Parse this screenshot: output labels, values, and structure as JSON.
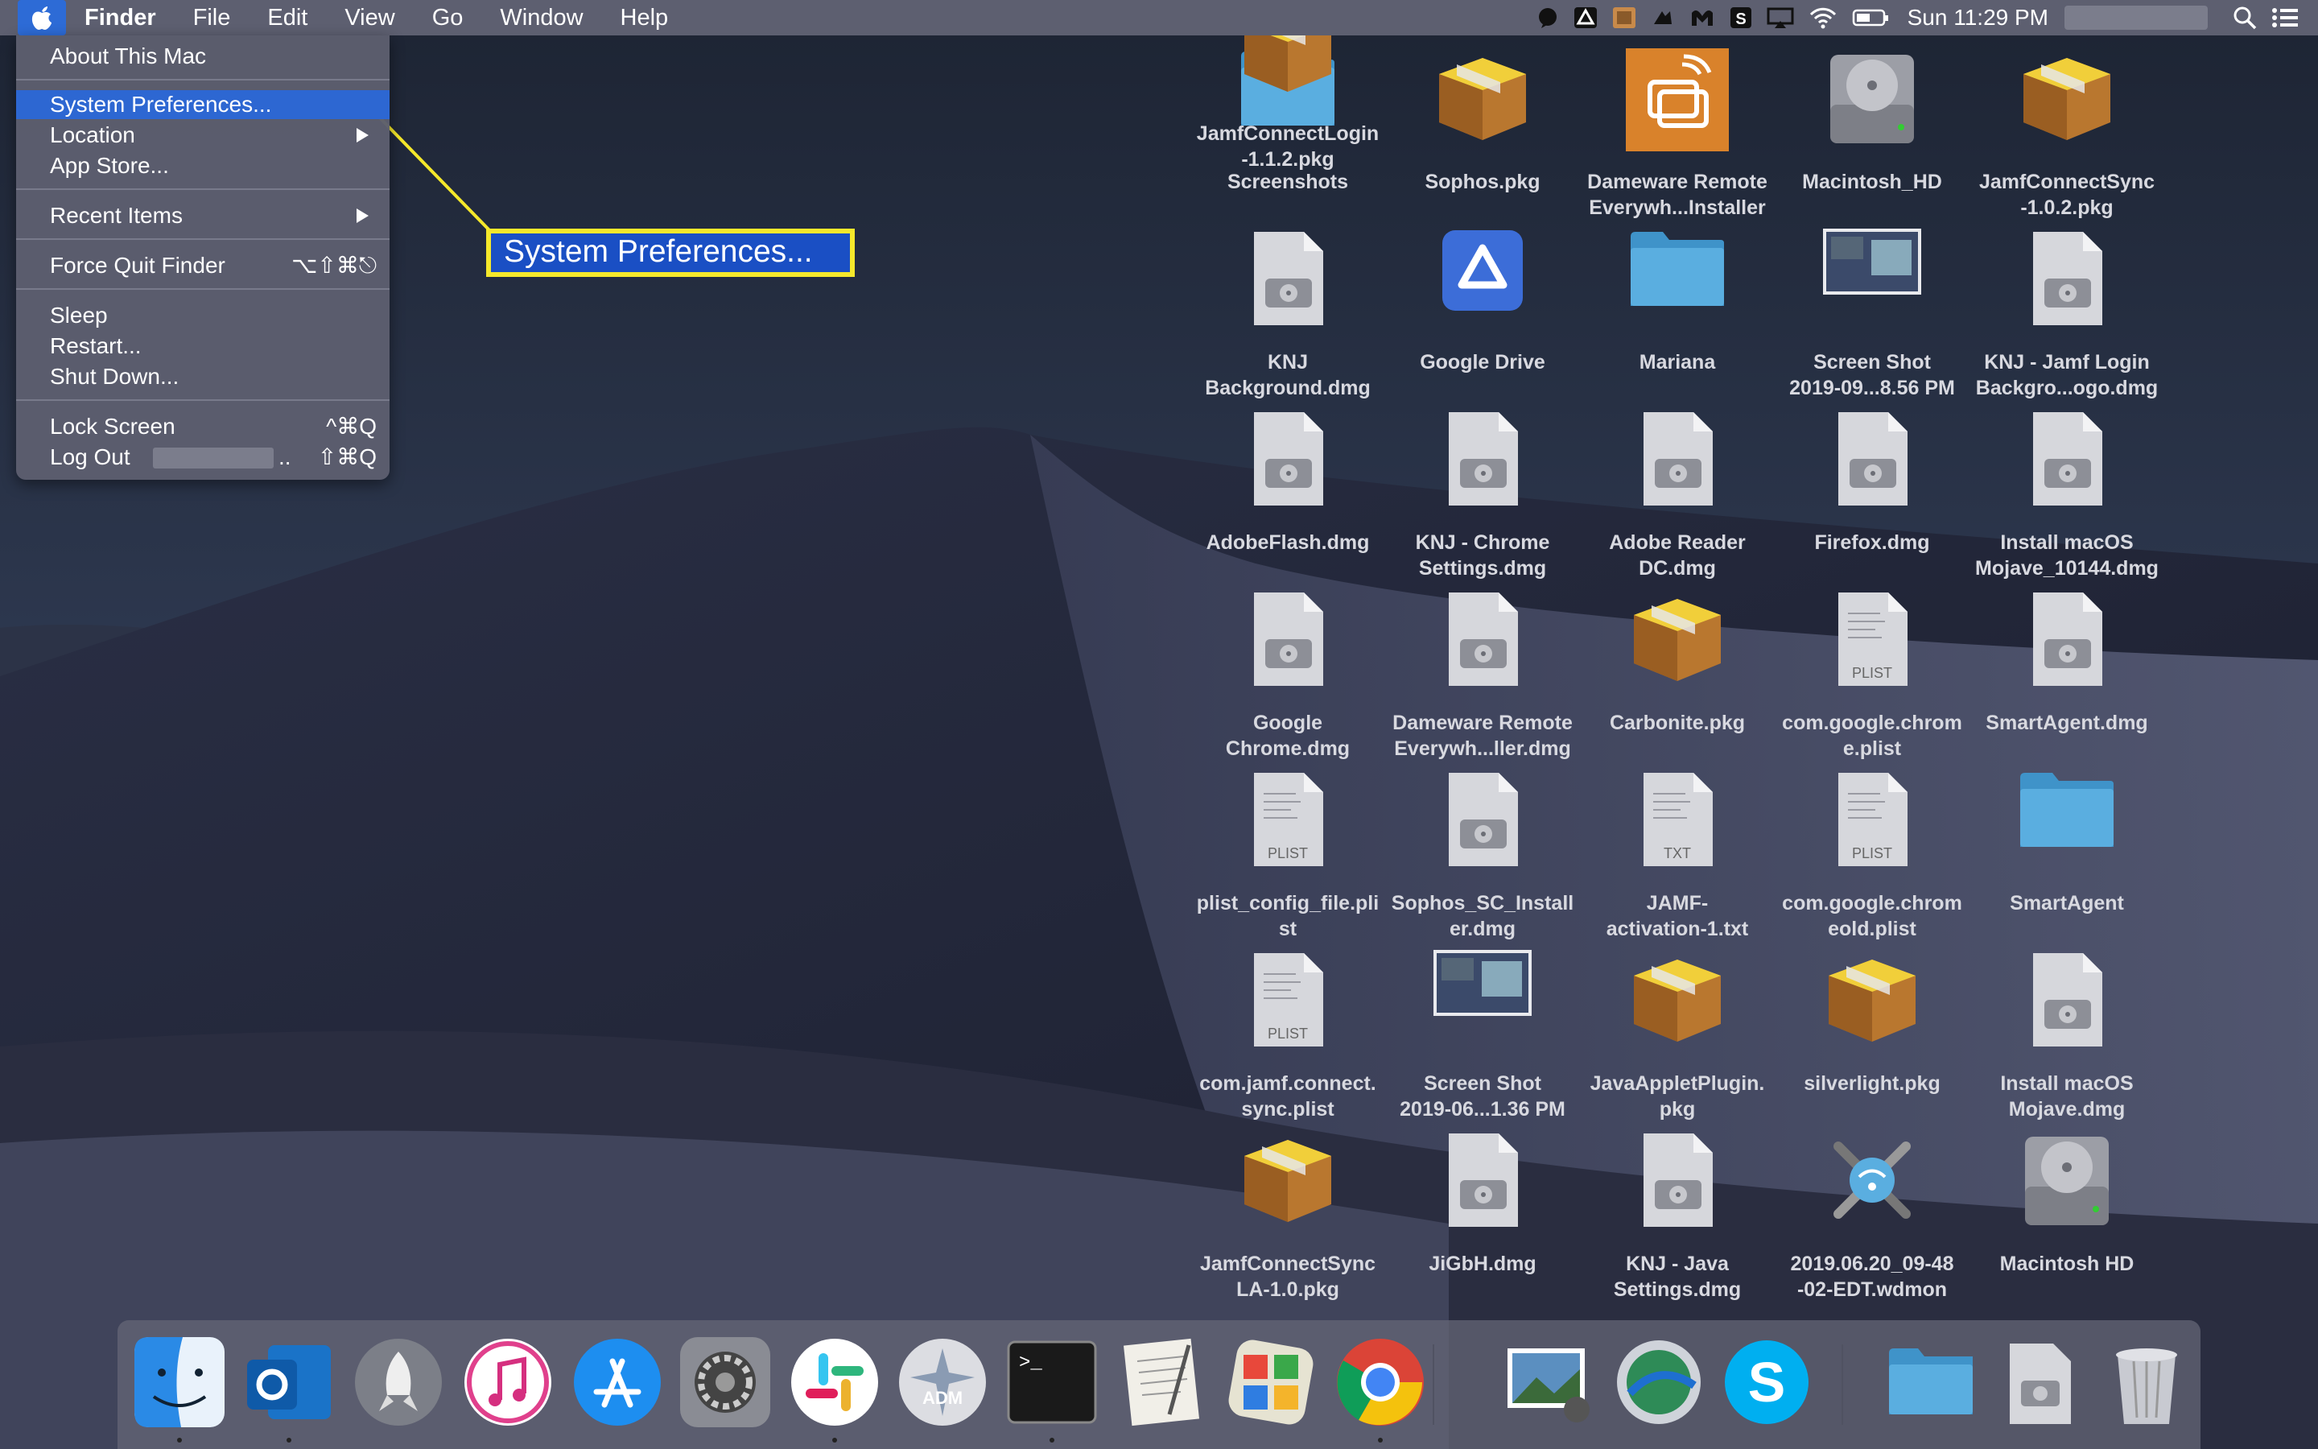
{
  "menubar": {
    "app_name": "Finder",
    "menus": [
      "File",
      "Edit",
      "View",
      "Go",
      "Window",
      "Help"
    ],
    "clock": "Sun 11:29 PM",
    "status_icons": [
      "notification-icon",
      "google-drive-icon",
      "menu-app-icon",
      "dropbox-like-icon",
      "malwarebytes-icon",
      "skype-status-icon",
      "airplay-icon",
      "wifi-icon",
      "battery-icon",
      "spotlight-search-icon",
      "notification-center-icon"
    ]
  },
  "apple_menu": {
    "items": [
      {
        "label": "About This Mac",
        "shortcut": ""
      },
      {
        "label": "System Preferences...",
        "shortcut": "",
        "highlighted": true
      },
      {
        "label": "Location",
        "shortcut": "",
        "submenu": true
      },
      {
        "label": "App Store...",
        "shortcut": ""
      },
      {
        "label": "Recent Items",
        "shortcut": "",
        "submenu": true
      },
      {
        "label": "Force Quit Finder",
        "shortcut": "⌥⇧⌘⎋"
      },
      {
        "label": "Sleep",
        "shortcut": ""
      },
      {
        "label": "Restart...",
        "shortcut": ""
      },
      {
        "label": "Shut Down...",
        "shortcut": ""
      },
      {
        "label": "Lock Screen",
        "shortcut": "^⌘Q"
      },
      {
        "label": "Log Out",
        "shortcut": "⇧⌘Q",
        "suffix": ".."
      }
    ]
  },
  "callout": {
    "label": "System Preferences...",
    "color": "#f5e82b"
  },
  "desktop_icons": [
    {
      "label": "Screenshots",
      "icon": "folder-icon"
    },
    {
      "label": "Sophos.pkg",
      "icon": "package-icon"
    },
    {
      "label": "Dameware Remote\nEverywh...Installer",
      "icon": "dameware-app-icon"
    },
    {
      "label": "Macintosh_HD",
      "icon": "hard-drive-icon"
    },
    {
      "label": "JamfConnectSync\n-1.0.2.pkg",
      "icon": "package-icon"
    },
    {
      "label": "KNJ\nBackground.dmg",
      "icon": "disk-image-icon"
    },
    {
      "label": "Google Drive",
      "icon": "google-drive-icon"
    },
    {
      "label": "Mariana",
      "icon": "folder-icon"
    },
    {
      "label": "Screen Shot\n2019-09...8.56 PM",
      "icon": "screenshot-thumbnail-icon"
    },
    {
      "label": "KNJ - Jamf Login\nBackgro...ogo.dmg",
      "icon": "disk-image-icon"
    },
    {
      "label": "AdobeFlash.dmg",
      "icon": "disk-image-icon"
    },
    {
      "label": "KNJ - Chrome\nSettings.dmg",
      "icon": "disk-image-icon"
    },
    {
      "label": "Adobe Reader\nDC.dmg",
      "icon": "disk-image-icon"
    },
    {
      "label": "Firefox.dmg",
      "icon": "disk-image-icon"
    },
    {
      "label": "Install macOS\nMojave_10144.dmg",
      "icon": "disk-image-icon"
    },
    {
      "label": "Google\nChrome.dmg",
      "icon": "disk-image-icon"
    },
    {
      "label": "Dameware Remote\nEverywh...ller.dmg",
      "icon": "disk-image-icon"
    },
    {
      "label": "Carbonite.pkg",
      "icon": "package-icon"
    },
    {
      "label": "com.google.chrom\ne.plist",
      "icon": "plist-file-icon",
      "badge": "PLIST"
    },
    {
      "label": "SmartAgent.dmg",
      "icon": "disk-image-icon"
    },
    {
      "label": "plist_config_file.pli\nst",
      "icon": "plist-file-icon",
      "badge": "PLIST"
    },
    {
      "label": "Sophos_SC_Install\ner.dmg",
      "icon": "disk-image-icon"
    },
    {
      "label": "JAMF-\nactivation-1.txt",
      "icon": "text-file-icon",
      "badge": "TXT"
    },
    {
      "label": "com.google.chrom\neold.plist",
      "icon": "plist-file-icon",
      "badge": "PLIST"
    },
    {
      "label": "SmartAgent",
      "icon": "folder-icon"
    },
    {
      "label": "com.jamf.connect.\nsync.plist",
      "icon": "plist-file-icon",
      "badge": "PLIST"
    },
    {
      "label": "Screen Shot\n2019-06...1.36 PM",
      "icon": "screenshot-thumbnail-icon"
    },
    {
      "label": "JavaAppletPlugin.\npkg",
      "icon": "package-icon"
    },
    {
      "label": "silverlight.pkg",
      "icon": "package-icon"
    },
    {
      "label": "Install macOS\nMojave.dmg",
      "icon": "disk-image-icon"
    },
    {
      "label": "JamfConnectSync\nLA-1.0.pkg",
      "icon": "package-icon"
    },
    {
      "label": "JiGbH.dmg",
      "icon": "disk-image-icon"
    },
    {
      "label": "KNJ - Java\nSettings.dmg",
      "icon": "disk-image-icon"
    },
    {
      "label": "2019.06.20_09-48\n-02-EDT.wdmon",
      "icon": "wireless-diagnostics-icon"
    },
    {
      "label": "Macintosh HD",
      "icon": "hard-drive-icon"
    },
    {
      "label": "JamfConnectLogin\n-1.1.2.pkg",
      "icon": "package-icon"
    }
  ],
  "dock": {
    "apps": [
      {
        "name": "finder-icon",
        "running": true
      },
      {
        "name": "outlook-icon",
        "running": true
      },
      {
        "name": "launchpad-icon",
        "running": false
      },
      {
        "name": "itunes-icon",
        "running": false
      },
      {
        "name": "app-store-icon",
        "running": false
      },
      {
        "name": "system-preferences-icon",
        "running": false
      },
      {
        "name": "slack-icon",
        "running": true
      },
      {
        "name": "adm-icon",
        "running": false
      },
      {
        "name": "terminal-icon",
        "running": true
      },
      {
        "name": "textedit-icon",
        "running": false
      },
      {
        "name": "photo-app-icon",
        "running": false
      },
      {
        "name": "chrome-icon",
        "running": true
      },
      {
        "name": "preview-icon",
        "running": false
      },
      {
        "name": "vpn-client-icon",
        "running": false
      },
      {
        "name": "skype-icon",
        "running": false
      },
      {
        "name": "documents-stack-icon",
        "running": false
      },
      {
        "name": "downloads-stack-icon",
        "running": false
      },
      {
        "name": "trash-icon",
        "running": false
      }
    ],
    "adm_label": "ADM",
    "terminal_prompt": ">_"
  },
  "colors": {
    "menu_highlight": "#2d67d2",
    "callout_border": "#f5e82b",
    "folder": "#4ea8de"
  }
}
